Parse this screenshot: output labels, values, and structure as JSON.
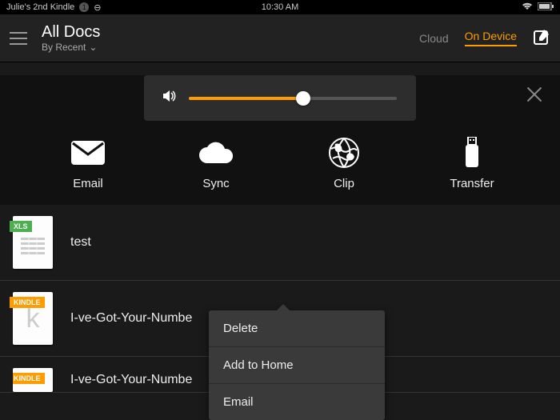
{
  "status": {
    "device_name": "Julie's 2nd Kindle",
    "badge": "1",
    "time": "10:30 AM"
  },
  "header": {
    "title": "All Docs",
    "subtitle": "By Recent",
    "tab_cloud": "Cloud",
    "tab_on_device": "On Device"
  },
  "volume": {
    "percent": 55
  },
  "actions": {
    "email": "Email",
    "sync": "Sync",
    "clip": "Clip",
    "transfer": "Transfer"
  },
  "docs": [
    {
      "badge": "XLS",
      "badge_class": "badge-xls",
      "title": "test",
      "thumb": "sheet"
    },
    {
      "badge": "KINDLE",
      "badge_class": "badge-kindle",
      "title": "I-ve-Got-Your-Numbe",
      "thumb": "k"
    },
    {
      "badge": "KINDLE",
      "badge_class": "badge-kindle",
      "title": "I-ve-Got-Your-Numbe",
      "thumb": "k"
    }
  ],
  "context_menu": {
    "items": [
      "Delete",
      "Add to Home",
      "Email"
    ]
  }
}
